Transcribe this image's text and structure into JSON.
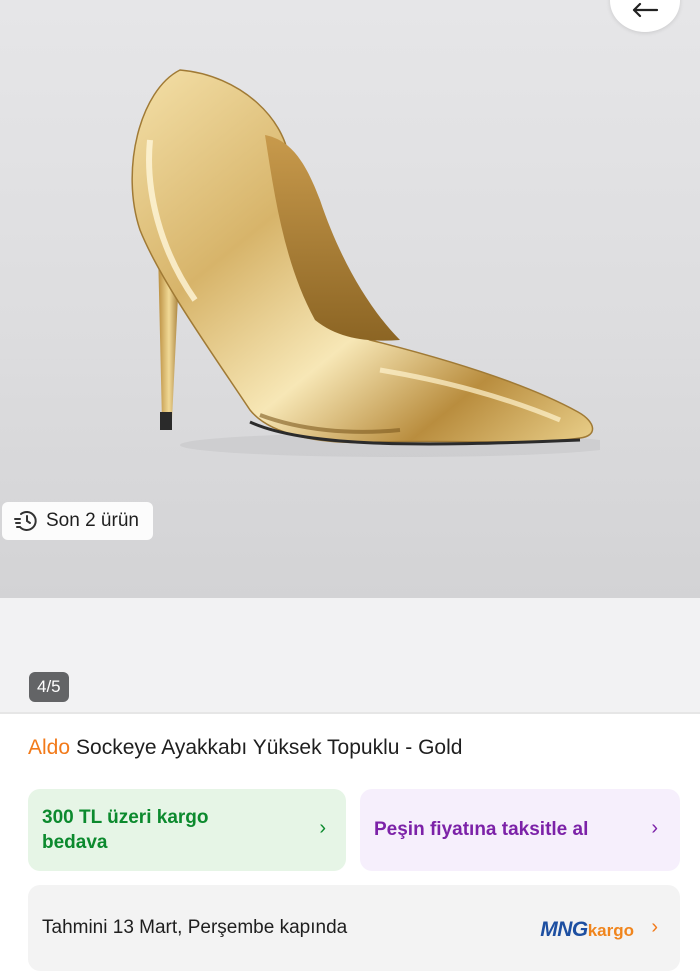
{
  "gallery": {
    "recent_label": "Son 2 ürün",
    "counter": "4/5"
  },
  "product": {
    "brand": "Aldo",
    "name": "Sockeye Ayakkabı Yüksek Topuklu - Gold"
  },
  "shipping_card": {
    "line1": "300 TL üzeri kargo",
    "line2": "bedava",
    "chevron": "›"
  },
  "installment_card": {
    "label": "Peşin fiyatına taksitle al",
    "chevron": "›"
  },
  "delivery_card": {
    "label": "Tahmini 13 Mart, Perşembe kapında",
    "carrier_logo_part1": "MNG",
    "carrier_logo_part2": "kargo",
    "chevron": "›"
  },
  "icons": {
    "back": "arrow-left-icon",
    "recent": "history-icon",
    "chevron": "chevron-right-icon"
  },
  "colors": {
    "brand_orange": "#f27a1a",
    "shipping_green": "#0c8a2e",
    "shipping_bg": "#e6f5e6",
    "installment_purple": "#7c22a8",
    "installment_bg": "#f6effc",
    "mng_blue": "#1d4fa1",
    "mng_orange": "#f0851d"
  }
}
